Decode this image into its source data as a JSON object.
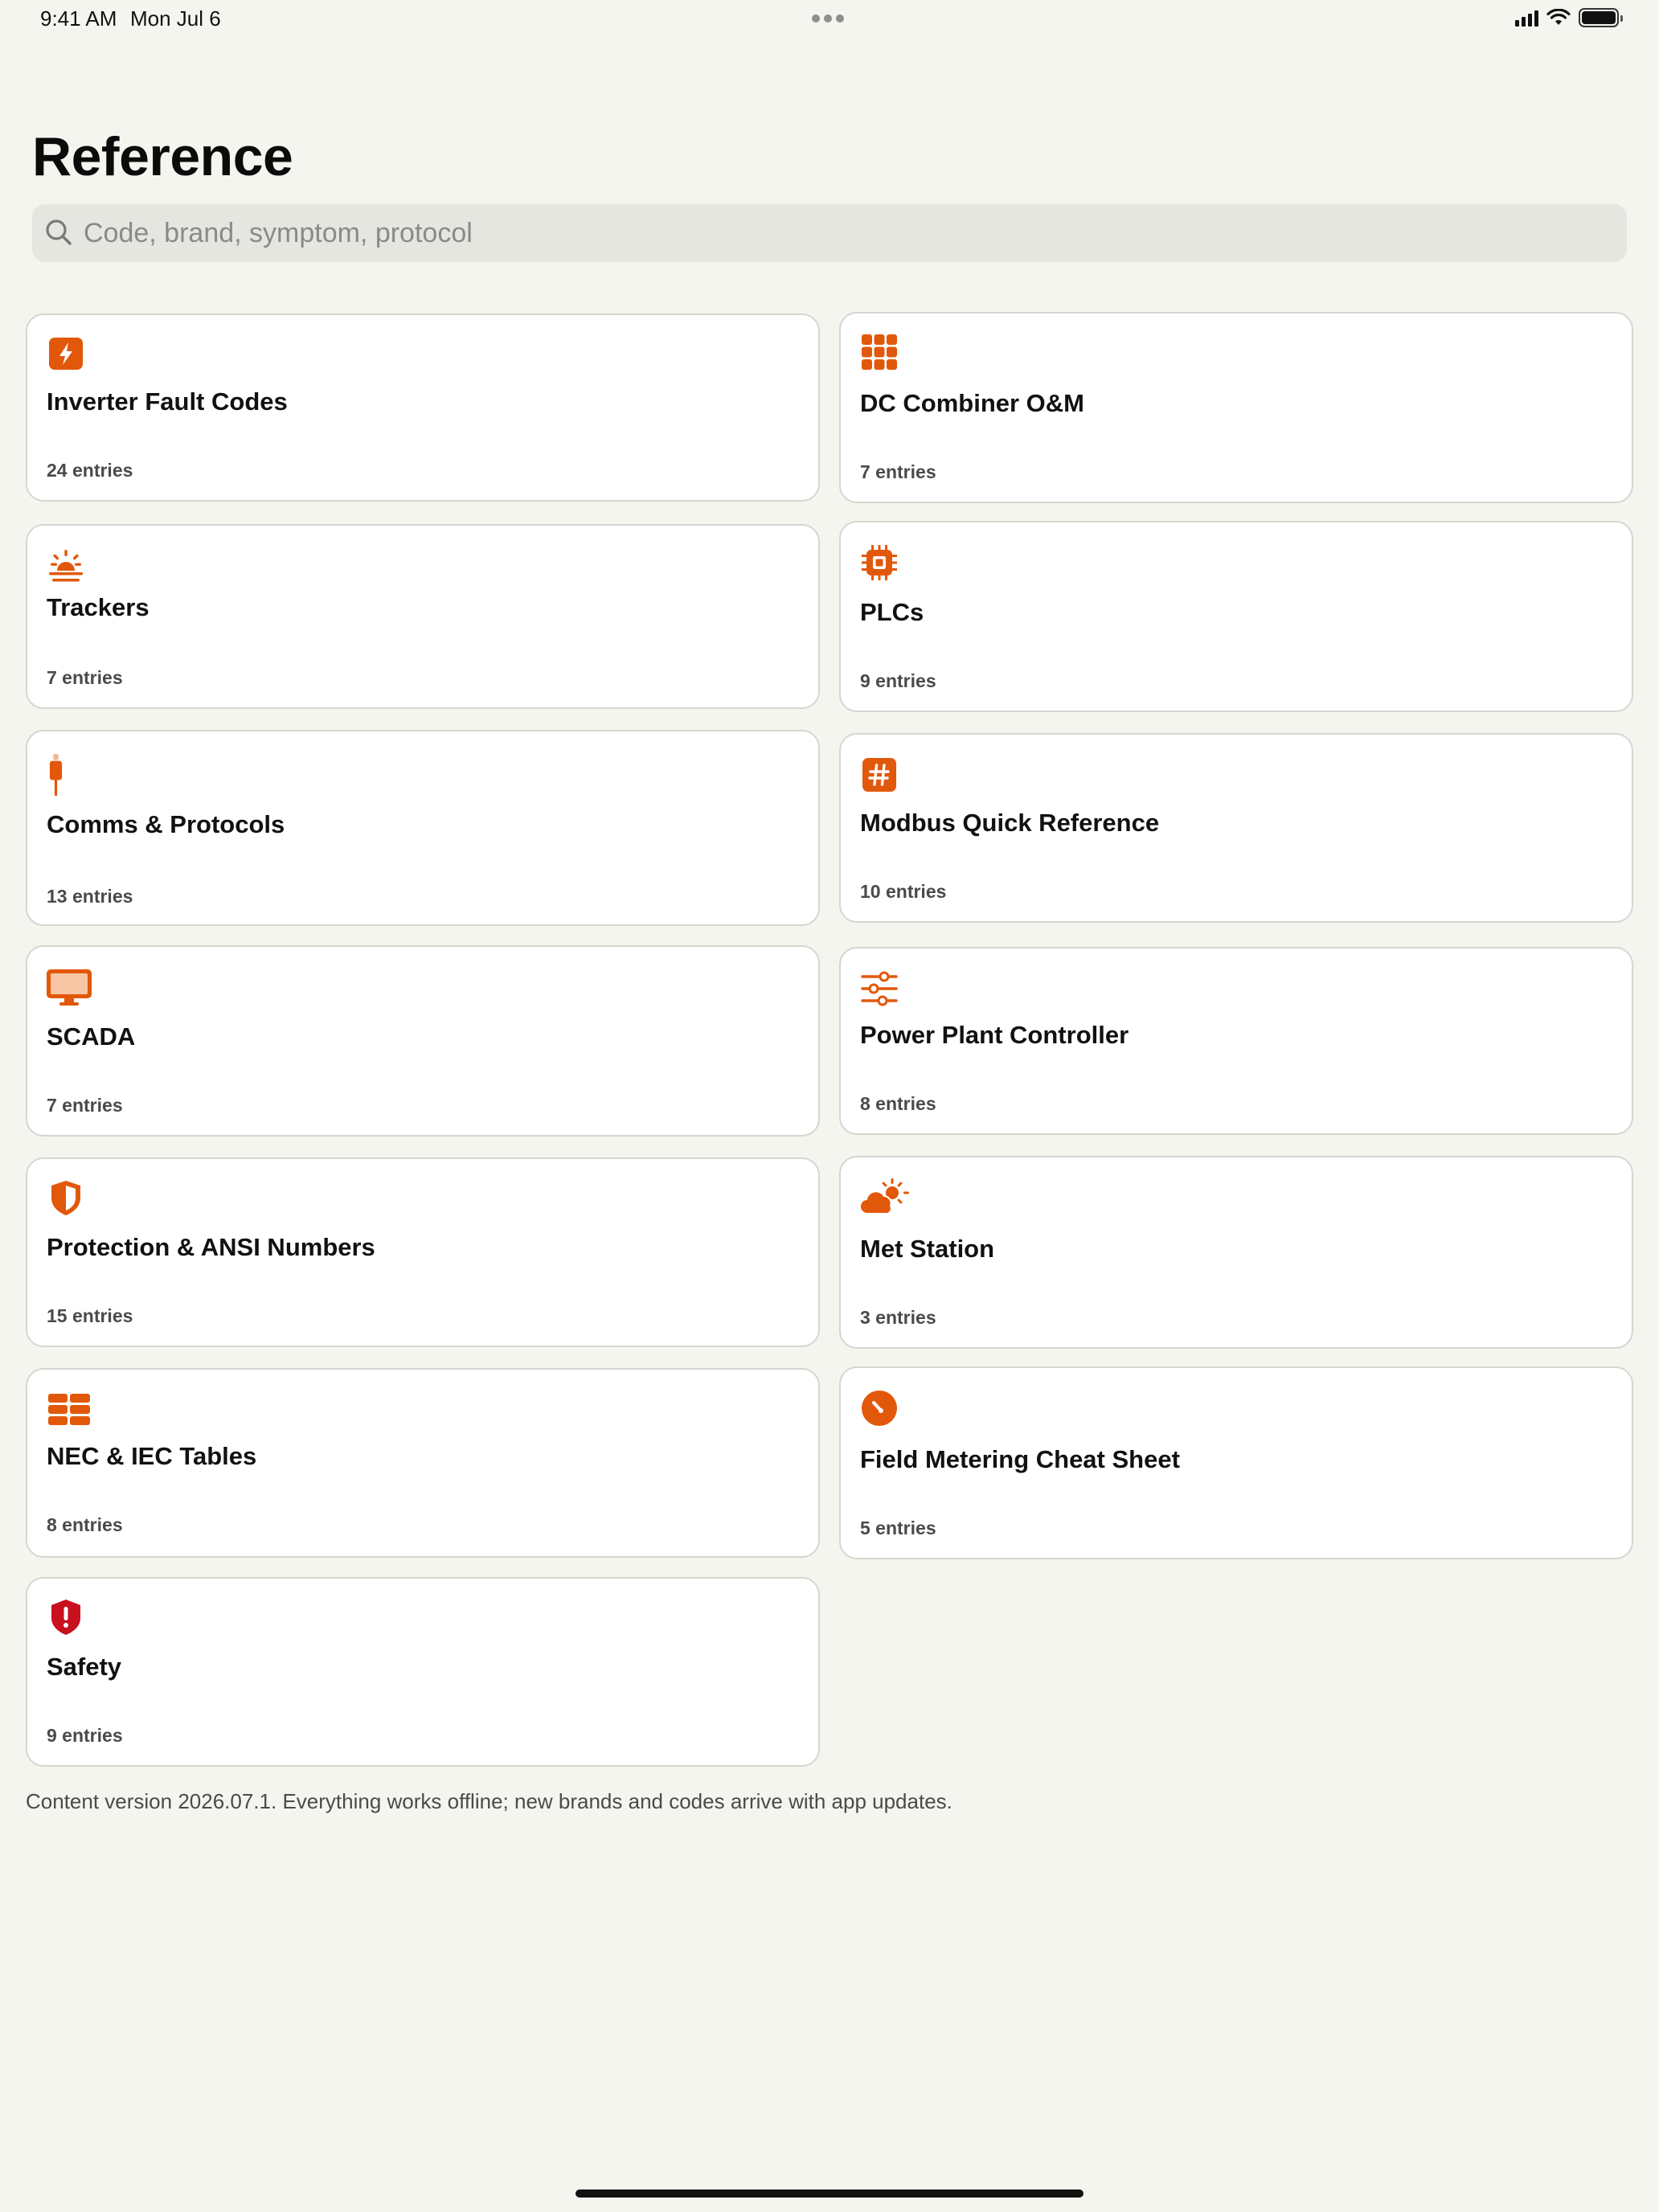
{
  "status_bar": {
    "time": "9:41 AM",
    "date": "Mon Jul 6"
  },
  "header": {
    "title": "Reference"
  },
  "search": {
    "placeholder": "Code, brand, symptom, protocol"
  },
  "colors": {
    "accent": "#e2580b",
    "safety": "#c8101e",
    "background": "#f5f5f0"
  },
  "cards": [
    {
      "title": "Inverter Fault Codes",
      "count": "24 entries",
      "icon": "bolt-icon"
    },
    {
      "title": "DC Combiner O&M",
      "count": "7 entries",
      "icon": "grid-icon"
    },
    {
      "title": "Trackers",
      "count": "7 entries",
      "icon": "sunrise-icon"
    },
    {
      "title": "PLCs",
      "count": "9 entries",
      "icon": "cpu-icon"
    },
    {
      "title": "Comms & Protocols",
      "count": "13 entries",
      "icon": "cable-connector-icon"
    },
    {
      "title": "Modbus Quick Reference",
      "count": "10 entries",
      "icon": "number-sign-icon"
    },
    {
      "title": "SCADA",
      "count": "7 entries",
      "icon": "monitor-icon"
    },
    {
      "title": "Power Plant Controller",
      "count": "8 entries",
      "icon": "sliders-icon"
    },
    {
      "title": "Protection & ANSI Numbers",
      "count": "15 entries",
      "icon": "shield-icon"
    },
    {
      "title": "Met Station",
      "count": "3 entries",
      "icon": "cloud-sun-icon"
    },
    {
      "title": "NEC & IEC Tables",
      "count": "8 entries",
      "icon": "table-icon"
    },
    {
      "title": "Field Metering Cheat Sheet",
      "count": "5 entries",
      "icon": "gauge-icon"
    },
    {
      "title": "Safety",
      "count": "9 entries",
      "icon": "exclamation-shield-icon"
    }
  ],
  "footer": {
    "note": "Content version 2026.07.1. Everything works offline; new brands and codes arrive with app updates."
  }
}
